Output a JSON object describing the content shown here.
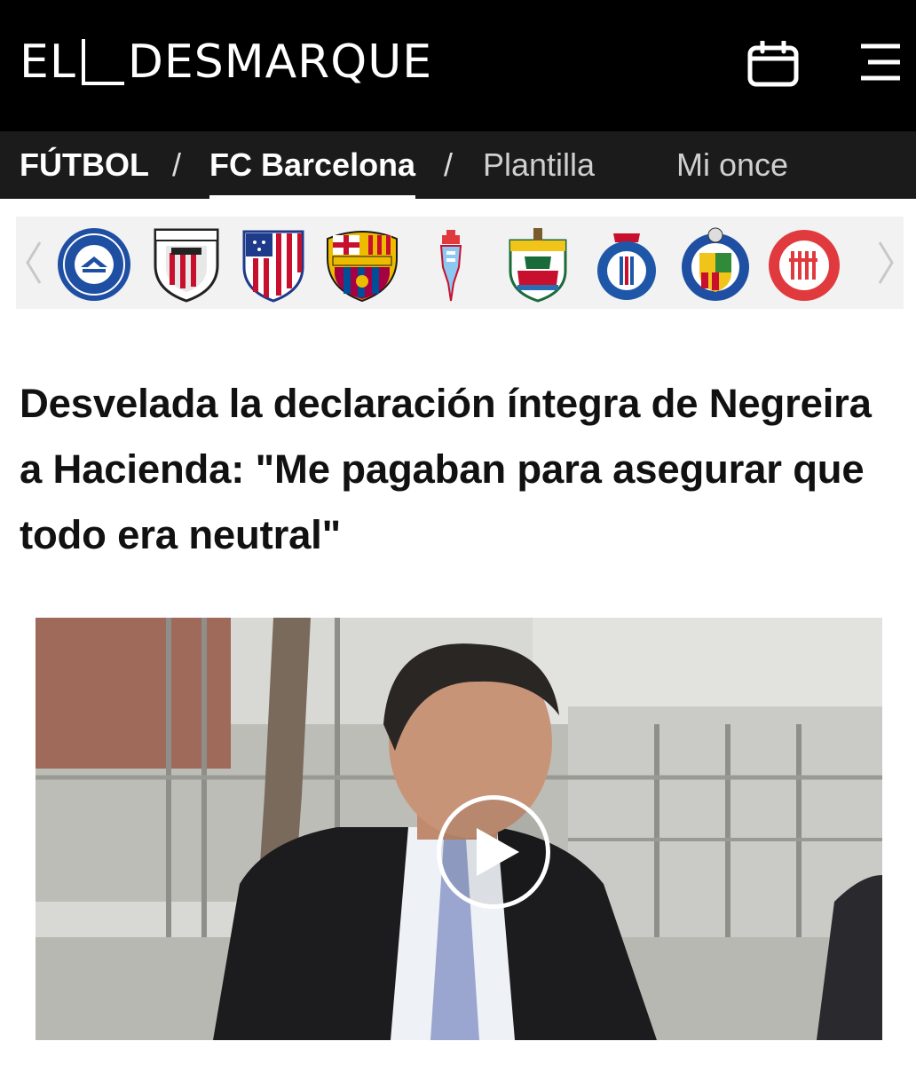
{
  "header": {
    "logo_left": "EL",
    "logo_right": "DESMARQUE",
    "calendar_icon": "calendar-icon",
    "menu_icon": "menu-icon",
    "background": "#000000"
  },
  "breadcrumb": {
    "items": [
      {
        "label": "FÚTBOL"
      },
      {
        "label": "FC Barcelona"
      },
      {
        "label": "Plantilla"
      },
      {
        "label": "Mi once"
      }
    ],
    "separator": "/"
  },
  "teams": {
    "crests": [
      {
        "label": "DEPORTIVO"
      },
      {
        "label": "ATHLETIC CLUB"
      },
      {
        "label": "Atlético de Madrid"
      },
      {
        "label": "FCB"
      },
      {
        "label": "Celta"
      },
      {
        "label": "ELCHE"
      },
      {
        "label": "RCD ESPANYOL"
      },
      {
        "label": "GETAFE C.F. S.A.D."
      },
      {
        "label": "GIRONA"
      }
    ],
    "prev_icon": "chevron-left-icon",
    "next_icon": "chevron-right-icon"
  },
  "article": {
    "headline": "Desvelada la declaración íntegra de Negreira a Hacienda: \"Me pagaban para asegurar que todo era neutral\""
  },
  "video": {
    "play_icon": "play-icon",
    "accent": "#ffffff"
  }
}
